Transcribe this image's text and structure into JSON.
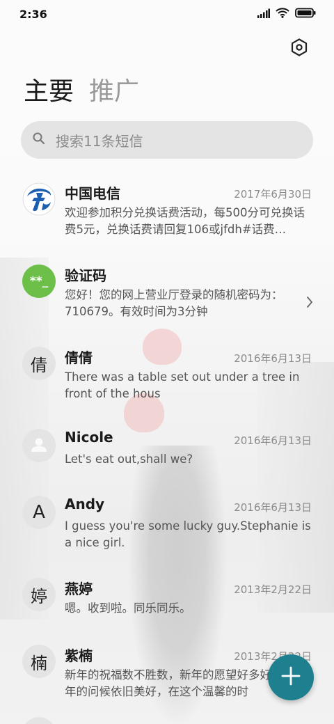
{
  "status_bar": {
    "time": "2:36"
  },
  "tabs": [
    {
      "label": "主要",
      "active": true
    },
    {
      "label": "推广",
      "active": false
    }
  ],
  "search": {
    "placeholder": "搜索11条短信"
  },
  "conversations": [
    {
      "name": "中国电信",
      "date": "2017年6月30日",
      "preview": "欢迎参加积分兑换话费活动，每500分可兑换话费5元，兑换话费请回复106或jfdh#话费…",
      "avatar_type": "logo",
      "avatar_icon": "china-telecom-logo"
    },
    {
      "name": "验证码",
      "date": "",
      "preview": "您好！您的网上营业厅登录的随机密码为：710679。有效时间为3分钟",
      "avatar_type": "code",
      "avatar_text": "**_",
      "avatar_color": "#6cc04a"
    },
    {
      "name": "倩倩",
      "date": "2016年6月13日",
      "preview": "There was a table set out under a tree in front of the hous",
      "avatar_type": "letter",
      "avatar_text": "倩"
    },
    {
      "name": "Nicole",
      "date": "2016年6月13日",
      "preview": "Let's eat out,shall we?",
      "avatar_type": "person",
      "avatar_icon": "person-icon"
    },
    {
      "name": "Andy",
      "date": "2016年6月13日",
      "preview": "I guess you're some lucky guy.Stephanie is a nice girl.",
      "avatar_type": "letter",
      "avatar_text": "A"
    },
    {
      "name": "燕婷",
      "date": "2013年2月22日",
      "preview": "嗯。收到啦。同乐同乐。",
      "avatar_type": "letter",
      "avatar_text": "婷"
    },
    {
      "name": "紫楠",
      "date": "2013年2月22日",
      "preview": "新年的祝福数不胜数，新年的愿望好多好多，新年的问候依旧美好，在这个温馨的时",
      "avatar_type": "letter",
      "avatar_text": "楠"
    }
  ],
  "fab": {
    "icon": "plus-icon",
    "color": "#1e7f8e"
  }
}
